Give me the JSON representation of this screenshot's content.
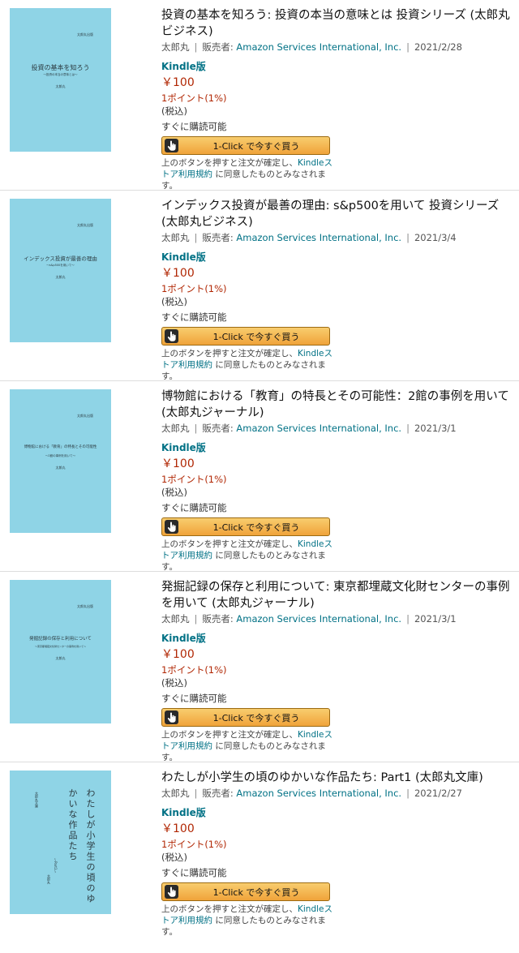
{
  "items": [
    {
      "title": "投資の基本を知ろう: 投資の本当の意味とは 投資シリーズ (太郎丸ビジネス)",
      "author": "太郎丸",
      "seller_label": "販売者:",
      "seller": "Amazon Services International, Inc.",
      "date": "2021/2/28",
      "format": "Kindle版",
      "price": "￥100",
      "points": "1ポイント(1%)",
      "tax": "(税込)",
      "availability": "すぐに購読可能",
      "button": "1-Click で今すぐ買う",
      "note_pre": "上のボタンを押すと注文が確定し、",
      "note_link": "Kindleストア利用規約",
      "note_post": "に同意したものとみなされます。",
      "cover": {
        "publisher": "太郎丸出版",
        "title": "投資の基本を知ろう",
        "subtitle": "〜投資の本当の意味とは〜",
        "author": "太郎丸"
      }
    },
    {
      "title": "インデックス投資が最善の理由: s&p500を用いて 投資シリーズ (太郎丸ビジネス)",
      "author": "太郎丸",
      "seller_label": "販売者:",
      "seller": "Amazon Services International, Inc.",
      "date": "2021/3/4",
      "format": "Kindle版",
      "price": "￥100",
      "points": "1ポイント(1%)",
      "tax": "(税込)",
      "availability": "すぐに購読可能",
      "button": "1-Click で今すぐ買う",
      "note_pre": "上のボタンを押すと注文が確定し、",
      "note_link": "Kindleストア利用規約",
      "note_post": "に同意したものとみなされます。",
      "cover": {
        "publisher": "太郎丸出版",
        "title": "インデックス投資が最善の理由",
        "subtitle": "〜s&p500を用いて〜",
        "author": "太郎丸"
      }
    },
    {
      "title": "博物館における「教育」の特長とその可能性：2館の事例を用いて (太郎丸ジャーナル)",
      "author": "太郎丸",
      "seller_label": "販売者:",
      "seller": "Amazon Services International, Inc.",
      "date": "2021/3/1",
      "format": "Kindle版",
      "price": "￥100",
      "points": "1ポイント(1%)",
      "tax": "(税込)",
      "availability": "すぐに購読可能",
      "button": "1-Click で今すぐ買う",
      "note_pre": "上のボタンを押すと注文が確定し、",
      "note_link": "Kindleストア利用規約",
      "note_post": "に同意したものとみなされます。",
      "cover": {
        "publisher": "太郎丸出版",
        "title": "博物館における「教育」の特長とその可能性",
        "subtitle": "〜2館の事例を用いて〜",
        "author": "太郎丸"
      }
    },
    {
      "title": "発掘記録の保存と利用について: 東京都埋蔵文化財センターの事例を用いて (太郎丸ジャーナル)",
      "author": "太郎丸",
      "seller_label": "販売者:",
      "seller": "Amazon Services International, Inc.",
      "date": "2021/3/1",
      "format": "Kindle版",
      "price": "￥100",
      "points": "1ポイント(1%)",
      "tax": "(税込)",
      "availability": "すぐに購読可能",
      "button": "1-Click で今すぐ買う",
      "note_pre": "上のボタンを押すと注文が確定し、",
      "note_link": "Kindleストア利用規約",
      "note_post": "に同意したものとみなされます。",
      "cover": {
        "publisher": "太郎丸出版",
        "title": "発掘記録の保存と利用について",
        "subtitle": "〜東京都埋蔵文化財センターの事例を用いて〜",
        "author": "太郎丸"
      }
    },
    {
      "title": "わたしが小学生の頃のゆかいな作品たち: Part1 (太郎丸文庫)",
      "author": "太郎丸",
      "seller_label": "販売者:",
      "seller": "Amazon Services International, Inc.",
      "date": "2021/2/27",
      "format": "Kindle版",
      "price": "￥100",
      "points": "1ポイント(1%)",
      "tax": "(税込)",
      "availability": "すぐに購読可能",
      "button": "1-Click で今すぐ買う",
      "note_pre": "上のボタンを押すと注文が確定し、",
      "note_link": "Kindleストア利用規約",
      "note_post": "に同意したものとみなされます。",
      "cover": {
        "publisher": "太郎丸文庫",
        "title_line1": "わたしが小学生の頃のゆ",
        "title_line2": "かいな作品たち",
        "subtitle": "〜Part1〜",
        "author": "太郎丸"
      }
    }
  ],
  "colors": {
    "link": "#007185",
    "price": "#b12704",
    "button": "#f0a33a",
    "cover": "#8fd4e6"
  },
  "icons": {
    "buy_button": "hand-pointer-icon"
  }
}
